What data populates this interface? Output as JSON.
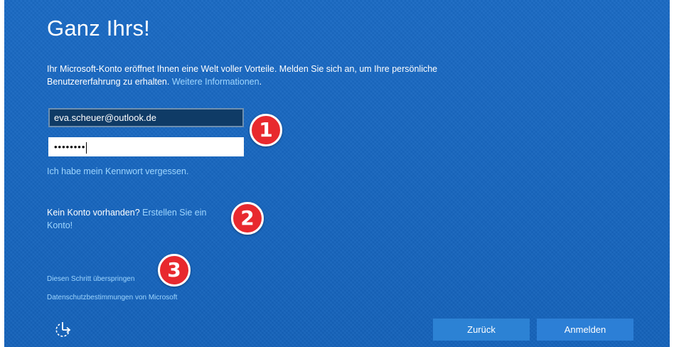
{
  "page": {
    "title": "Ganz Ihrs!",
    "intro_text": "Ihr Microsoft-Konto eröffnet Ihnen eine Welt voller Vorteile. Melden Sie sich an, um Ihre persönliche Benutzererfahrung zu erhalten. ",
    "intro_link": "Weitere Informationen",
    "intro_suffix": "."
  },
  "form": {
    "email_value": "eva.scheuer@outlook.de",
    "password_value": "••••••••",
    "forgot_password": "Ich habe mein Kennwort vergessen."
  },
  "account": {
    "no_account_text": "Kein Konto vorhanden? ",
    "create_link": "Erstellen Sie ein Konto!"
  },
  "footer_links": {
    "skip": "Diesen Schritt überspringen",
    "privacy": "Datenschutzbestimmungen von Microsoft"
  },
  "buttons": {
    "back": "Zurück",
    "sign_in": "Anmelden"
  },
  "annotations": [
    "1",
    "2",
    "3"
  ],
  "icons": {
    "ease_of_access": "ease-of-access-icon"
  },
  "colors": {
    "background": "#1565c0",
    "link": "#9ed6ff",
    "badge": "#e8292e",
    "button": "#2c82d4"
  }
}
